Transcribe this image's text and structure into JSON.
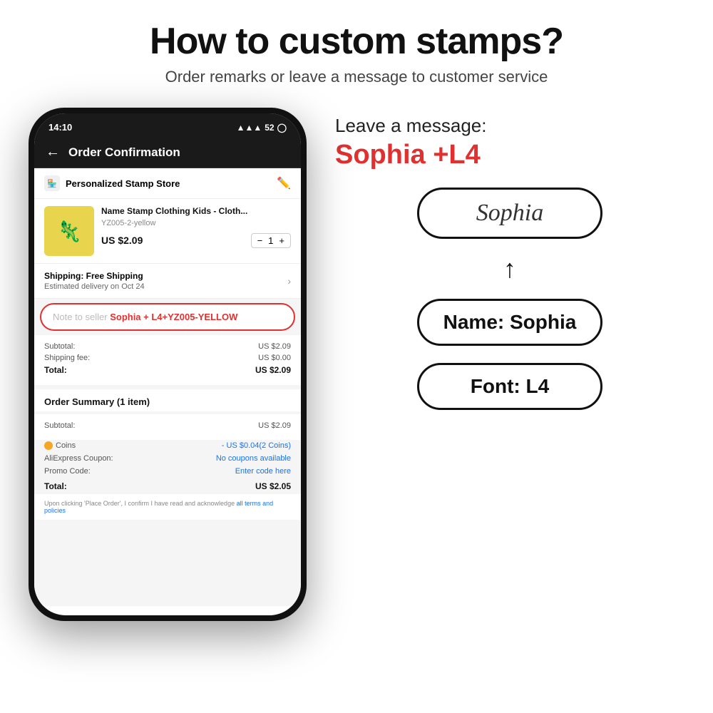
{
  "header": {
    "main_title": "How to custom stamps?",
    "subtitle": "Order remarks or leave a message to customer service"
  },
  "phone": {
    "status_bar": {
      "time": "14:10",
      "signal": "52",
      "signal_icon": "▲▲▲"
    },
    "screen_title": "Order Confirmation",
    "store_name": "Personalized Stamp Store",
    "product": {
      "name": "Name Stamp Clothing Kids - Cloth...",
      "sku": "YZ005-2-yellow",
      "price": "US $2.09",
      "qty": "1"
    },
    "shipping": {
      "title": "Shipping: Free Shipping",
      "subtitle": "Estimated delivery on Oct 24"
    },
    "note_seller": {
      "prefix": "Note to seller ",
      "highlight": "Sophia + L4+YZ005-YELLOW"
    },
    "summary": {
      "subtotal_label": "Subtotal:",
      "subtotal_value": "US $2.09",
      "shipping_label": "Shipping fee:",
      "shipping_value": "US $0.00",
      "total_label": "Total:",
      "total_value": "US $2.09"
    },
    "order_section": {
      "title": "Order Summary (1 item)",
      "subtotal_label": "Subtotal:",
      "subtotal_value": "US $2.09",
      "coins_label": "Coins",
      "coins_value": "- US $0.04(2 Coins)",
      "coupon_label": "AliExpress Coupon:",
      "coupon_value": "No coupons available",
      "promo_label": "Promo Code:",
      "promo_value": "Enter code here",
      "total_label": "Total:",
      "total_value": "US $2.05"
    },
    "place_order_text": "Upon clicking 'Place Order', I confirm I have read and acknowledge ",
    "place_order_link": "all terms and policies"
  },
  "right_panel": {
    "leave_label": "Leave a message:",
    "leave_value": "Sophia +L4",
    "stamp_preview_text": "Sophia",
    "name_box_text": "Name: Sophia",
    "font_box_text": "Font: L4",
    "arrow_char": "↑"
  }
}
